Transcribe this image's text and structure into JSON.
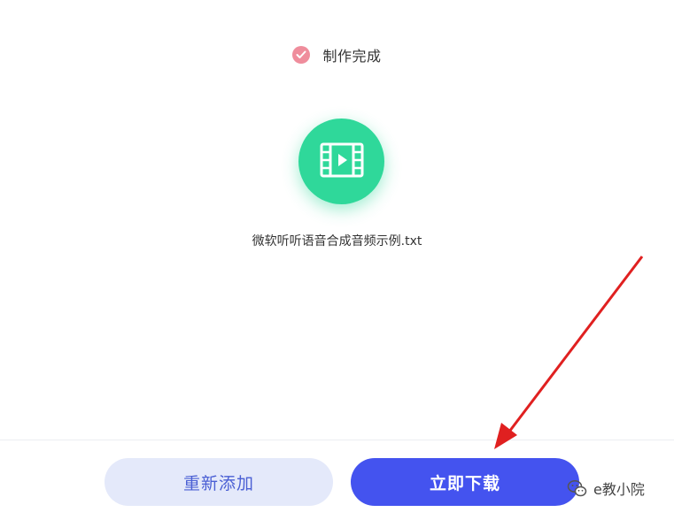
{
  "status": {
    "icon": "check-circle-icon",
    "text": "制作完成",
    "icon_color": "#ef8d9c"
  },
  "media": {
    "icon": "video-film-icon",
    "circle_color": "#2fd89a",
    "filename": "微软听听语音合成音频示例.txt"
  },
  "actions": {
    "readd_label": "重新添加",
    "download_label": "立即下载",
    "readd_bg": "#e4e9fa",
    "download_bg": "#4453ef"
  },
  "watermark": {
    "icon": "wechat-icon",
    "text": "e教小院"
  },
  "annotation": {
    "icon": "red-arrow",
    "color": "#e02020"
  }
}
